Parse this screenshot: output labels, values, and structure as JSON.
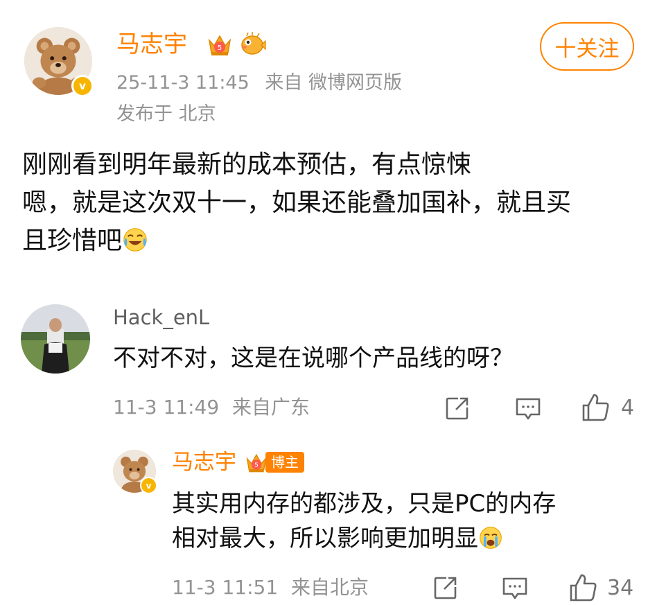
{
  "post": {
    "author": "马志宇",
    "time": "25-11-3 11:45",
    "source": "来自 微博网页版",
    "location": "发布于 北京",
    "follow_label": "十关注",
    "text_line1": "刚刚看到明年最新的成本预估，有点惊悚",
    "text_line2": "嗯，就是这次双十一，如果还能叠加国补，就且买",
    "text_line3": "且珍惜吧",
    "member_badge_level": "5"
  },
  "comments": [
    {
      "user": "Hack_enL",
      "text": "不对不对，这是在说哪个产品线的呀？",
      "time": "11-3 11:49",
      "location": "来自广东",
      "likes": "4"
    },
    {
      "user": "马志宇",
      "badge": "博主",
      "text_line1": "其实用内存的都涉及，只是PC的内存",
      "text_line2": "相对最大，所以影响更加明显",
      "time": "11-3 11:51",
      "location": "来自北京",
      "likes": "34"
    }
  ],
  "colors": {
    "accent": "#ff8200",
    "meta": "#939393",
    "verified": "#f7b500"
  }
}
